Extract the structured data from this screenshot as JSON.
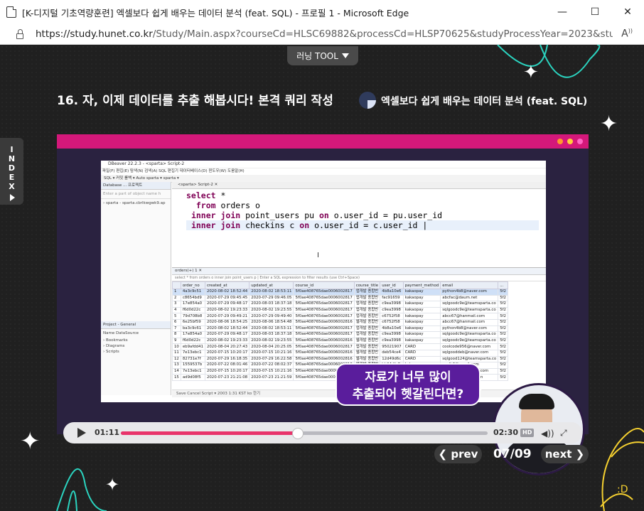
{
  "window": {
    "title": "[K-디지털 기초역량훈련] 엑셀보다 쉽게 배우는 데이터 분석 (feat. SQL) - 프로필 1 - Microsoft Edge",
    "minimize": "—",
    "maximize": "☐",
    "close": "✕"
  },
  "address": {
    "host": "https://study.hunet.co.kr",
    "path": "/Study/Main.aspx?courseCd=HLSC69882&processCd=HLSP70625&studyProcessYear=2023&studyProces...",
    "reader_icon": "read-aloud-icon"
  },
  "page": {
    "tool_label": "러닝 TOOL",
    "lesson_title": "16. 자, 이제 데이터를 추출 해봅시다! 본격 쿼리 작성",
    "course_name": "엑셀보다 쉽게 배우는 데이터 분석 (feat. SQL)",
    "index_label": [
      "I",
      "N",
      "D",
      "E",
      "X"
    ],
    "explain_tag": "(친절한) 해설",
    "page_indicator": "07/09",
    "prev_label": "prev",
    "next_label": "next"
  },
  "dbeaver": {
    "window_title": "DBeaver 22.2.3 - <sparta> Script-2",
    "menu": "파일(F)  편집(E)  탐색(N)  검색(A)  SQL 편집기  데이터베이스(D)  윈도우(W)  도움말(H)",
    "toolbar": "SQL ▾  커밋  롤백  ▾  Auto    sparta ▾   sparta ▾",
    "db_nav_head": "Database ...   프로젝트",
    "db_nav_filter": "Enter a part of object name h",
    "db_nav_item": "› sparta - sparta.cbrlkwgwk9.ap",
    "project_head": "Project - General",
    "project_cols": "Name                 DataSource",
    "project_items": [
      "› Bookmarks",
      "› Diagrams",
      "› Scripts"
    ],
    "editor_tab": "<sparta> Script-2 ✕",
    "code": [
      {
        "kw1": "select",
        "rest": " *"
      },
      {
        "kw1": "from",
        "rest": " orders o"
      },
      {
        "kw1": "inner join",
        "rest": " point_users pu ",
        "kw2": "on",
        "rest2": " o.user_id = pu.user_id"
      },
      {
        "kw1": "inner join",
        "rest": " checkins c ",
        "kw2": "on",
        "rest2": " o.user_id = c.user_id"
      }
    ],
    "results_tab": "orders(+) 1 ✕",
    "results_filter": "select * from orders o inner join point_users p  |  Enter a SQL expression to filter results (use Ctrl+Space)",
    "columns": [
      "",
      "order_no",
      "created_at",
      "updated_at",
      "course_id",
      "course_title",
      "user_id",
      "payment_method",
      "email",
      "..."
    ],
    "rows": [
      [
        "1",
        "4a3c9c51",
        "2020-08-02 18:52:44",
        "2020-08-02 18:53:11",
        "5f0ae408765dae0006002817",
        "앱개발 종합반",
        "4b8a10e6",
        "kakaopay",
        "python4b8@naver.com",
        "5f2"
      ],
      [
        "2",
        "c8654bd9",
        "2020-07-29 09:45:45",
        "2020-07-29 09:46:05",
        "5f0ae408765dae0006002817",
        "앱개발 종합반",
        "fac91659",
        "kakaopay",
        "abcfac@daum.net",
        "5f2"
      ],
      [
        "3",
        "17e854a0",
        "2020-07-29 09:48:17",
        "2020-08-03 18:37:18",
        "5f0ae408765dae0006002817",
        "앱개발 종합반",
        "c9ea3998",
        "kakaopay",
        "sqlgoodc9e@teamsparta.co",
        "5f2"
      ],
      [
        "4",
        "f6d0d22c",
        "2020-08-02 19:23:33",
        "2020-08-02 19:23:55",
        "5f0ae408765dae0006002817",
        "앱개발 종합반",
        "c9ea3998",
        "kakaopay",
        "sqlgoodc9e@teamsparta.co",
        "5f2"
      ],
      [
        "5",
        "79d708b8",
        "2020-07-29 09:49:21",
        "2020-07-29 09:49:40",
        "5f0ae408765dae0006002817",
        "앱개발 종합반",
        "c6752f58",
        "kakaopay",
        "abcc67@hanmail.com",
        "5f2"
      ],
      [
        "6",
        "6e25bf59",
        "2020-08-06 18:54:25",
        "2020-08-06 18:54:48",
        "5f0ae408765dae0006002816",
        "웹개발 종합반",
        "c6752f58",
        "kakaopay",
        "abcc67@hanmail.com",
        "5f2"
      ],
      [
        "7",
        "ba3c9c61",
        "2020-08-02 18:52:44",
        "2020-08-02 18:53:11",
        "5f0ae408765dae0006002817",
        "앱개발 종합반",
        "4b8a10e6",
        "kakaopay",
        "python4b8@naver.com",
        "5f2"
      ],
      [
        "8",
        "17e854a0",
        "2020-07-29 09:48:17",
        "2020-08-03 18:37:18",
        "5f0ae408765dae0006002817",
        "앱개발 종합반",
        "c9ea3998",
        "kakaopay",
        "sqlgoodc9e@teamsparta.co",
        "5f2"
      ],
      [
        "9",
        "f6d0d22c",
        "2020-08-02 19:23:33",
        "2020-08-02 19:23:55",
        "5f0ae408765dae0006002816",
        "웹개발 종합반",
        "c9ea3998",
        "kakaopay",
        "sqlgoodc9e@teamsparta.co",
        "5f2"
      ],
      [
        "10",
        "eb9afdd41",
        "2020-08-04 20:27:43",
        "2020-08-04 20:25:05",
        "5f0ae408765dae0006002817",
        "앱개발 종합반",
        "95021907",
        "CARD",
        "coolcode956@naver.com",
        "5f2"
      ],
      [
        "11",
        "7e13ebc1",
        "2020-07-15 10:20:17",
        "2020-07-15 10:21:16",
        "5f0ae408765dae0006002816",
        "웹개발 종합반",
        "deb54ce4",
        "CARD",
        "sqlgooddeb@naver.com",
        "5f2"
      ],
      [
        "12",
        "82731e7f",
        "2020-07-29 16:18:35",
        "2020-07-29 16:22:58",
        "5f0ae408765dae0006002816",
        "웹개발 종합반",
        "12d49d6c",
        "CARD",
        "sqlgood124@teamsparta.co",
        "5f2"
      ],
      [
        "13",
        "1559537b",
        "2020-07-22 08:01:46",
        "2020-07-22 08:02:37",
        "5f0ae408765dae0006002816",
        "웹개발 종합반",
        "bb24dfe8",
        "kakaopay",
        "coolb6@gmail.com",
        "5f2"
      ],
      [
        "14",
        "7e13ebc1",
        "2020-07-15 10:20:17",
        "2020-07-15 10:21:16",
        "5f0ae408765dae0006002816",
        "웹개발 종합반",
        "deb54ce4",
        "CARD",
        "sqlgooddeb@naver.com",
        "5f2"
      ],
      [
        "15",
        "ad9d08f5",
        "2020-07-23 21:21:08",
        "2020-07-23 21:21:59",
        "5f0ae408765dae0006002816",
        "웹개발 종합반",
        "aa8d63a6",
        "kakaopay",
        "aa8d6@hanmail.com",
        "5f2"
      ]
    ],
    "results_footer": "Save   Cancel   Script   ▾   2003   1:31   KST   ko   한기"
  },
  "video": {
    "bubble_line1": "자료가 너무 많이",
    "bubble_line2": "추출되어 헷갈린다면?",
    "time_current": "01:11",
    "time_total": "02:30",
    "progress": 0.48,
    "hd_label": "HD"
  },
  "colors": {
    "accent_pink": "#d4187a",
    "progress_fill": "#e8336b",
    "bubble_purple": "#5a1d9c",
    "teal_line": "#2bd4c0",
    "doodle_yellow": "#f5d030"
  }
}
